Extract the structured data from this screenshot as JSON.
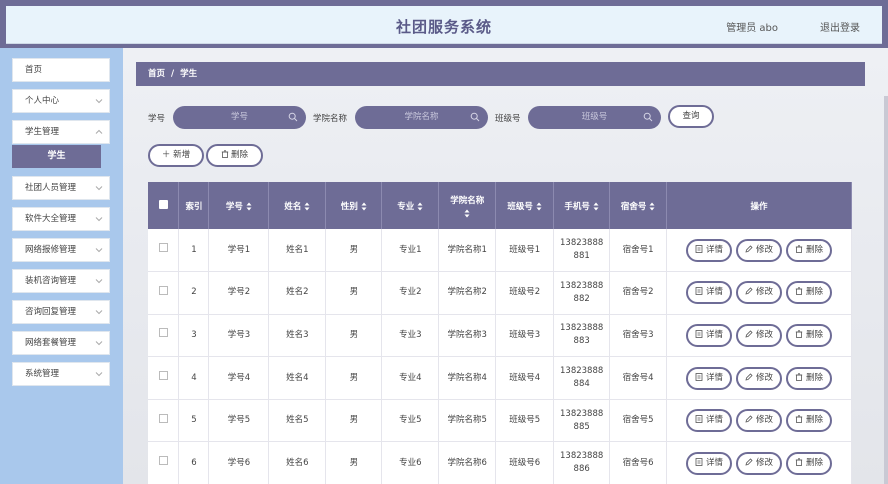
{
  "header": {
    "title": "社团服务系统",
    "admin": "管理员 abo",
    "logout": "退出登录"
  },
  "sidebar": {
    "items": [
      {
        "label": "首页"
      },
      {
        "label": "个人中心"
      },
      {
        "label": "学生管理"
      },
      {
        "label": "社团人员管理"
      },
      {
        "label": "软件大全管理"
      },
      {
        "label": "网络报修管理"
      },
      {
        "label": "装机咨询管理"
      },
      {
        "label": "咨询回复管理"
      },
      {
        "label": "网络套餐管理"
      },
      {
        "label": "系统管理"
      }
    ],
    "sub_item": "学生"
  },
  "breadcrumb": {
    "home": "首页",
    "sep": "/",
    "current": "学生"
  },
  "search": {
    "student_no_label": "学号",
    "student_no_placeholder": "学号",
    "college_label": "学院名称",
    "college_placeholder": "学院名称",
    "class_label": "班级号",
    "class_placeholder": "班级号",
    "query": "查询"
  },
  "actions": {
    "add": "新增",
    "delete": "删除"
  },
  "table": {
    "headers": {
      "index": "索引",
      "student_no": "学号",
      "name": "姓名",
      "gender": "性别",
      "major": "专业",
      "college": "学院名称",
      "class_no": "班级号",
      "phone": "手机号",
      "dorm": "宿舍号",
      "ops": "操作"
    },
    "op_labels": {
      "detail": "详情",
      "edit": "修改",
      "delete": "删除"
    },
    "rows": [
      {
        "index": "1",
        "student_no": "学号1",
        "name": "姓名1",
        "gender": "男",
        "major": "专业1",
        "college": "学院名称1",
        "class_no": "班级号1",
        "phone_a": "13823888",
        "phone_b": "881",
        "dorm": "宿舍号1"
      },
      {
        "index": "2",
        "student_no": "学号2",
        "name": "姓名2",
        "gender": "男",
        "major": "专业2",
        "college": "学院名称2",
        "class_no": "班级号2",
        "phone_a": "13823888",
        "phone_b": "882",
        "dorm": "宿舍号2"
      },
      {
        "index": "3",
        "student_no": "学号3",
        "name": "姓名3",
        "gender": "男",
        "major": "专业3",
        "college": "学院名称3",
        "class_no": "班级号3",
        "phone_a": "13823888",
        "phone_b": "883",
        "dorm": "宿舍号3"
      },
      {
        "index": "4",
        "student_no": "学号4",
        "name": "姓名4",
        "gender": "男",
        "major": "专业4",
        "college": "学院名称4",
        "class_no": "班级号4",
        "phone_a": "13823888",
        "phone_b": "884",
        "dorm": "宿舍号4"
      },
      {
        "index": "5",
        "student_no": "学号5",
        "name": "姓名5",
        "gender": "男",
        "major": "专业5",
        "college": "学院名称5",
        "class_no": "班级号5",
        "phone_a": "13823888",
        "phone_b": "885",
        "dorm": "宿舍号5"
      },
      {
        "index": "6",
        "student_no": "学号6",
        "name": "姓名6",
        "gender": "男",
        "major": "专业6",
        "college": "学院名称6",
        "class_no": "班级号6",
        "phone_a": "13823888",
        "phone_b": "886",
        "dorm": "宿舍号6"
      }
    ]
  },
  "colors": {
    "accent": "#6e6c96",
    "sidebar": "#a9c8ec",
    "header_bg": "#e8f3fb"
  }
}
